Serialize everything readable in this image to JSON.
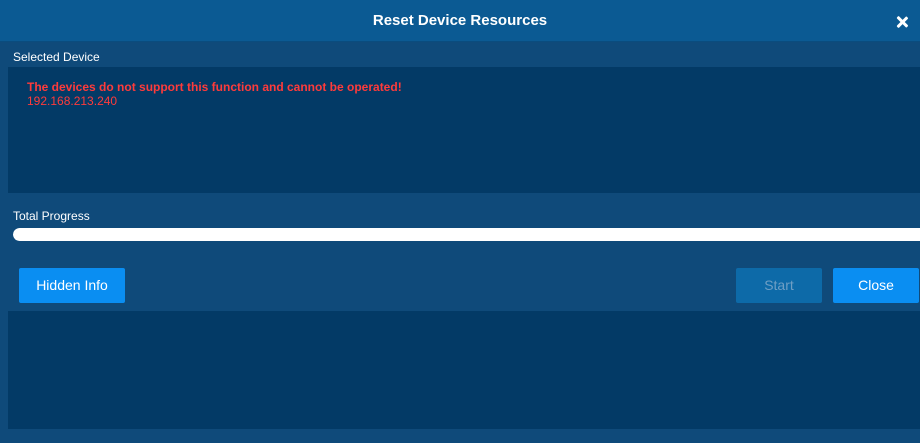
{
  "dialog": {
    "title": "Reset Device Resources",
    "close_icon": "close-icon"
  },
  "selected_device": {
    "label": "Selected Device",
    "error_message": "The devices do not support this function and cannot be operated!",
    "ip": "192.168.213.240"
  },
  "progress": {
    "label": "Total Progress",
    "fraction": 1.0
  },
  "buttons": {
    "hidden_info": "Hidden Info",
    "start": "Start",
    "close": "Close"
  },
  "colors": {
    "accent": "#0a8ef2",
    "error": "#ff3b3b",
    "panel": "#033a66",
    "background": "#0f4a7a"
  }
}
